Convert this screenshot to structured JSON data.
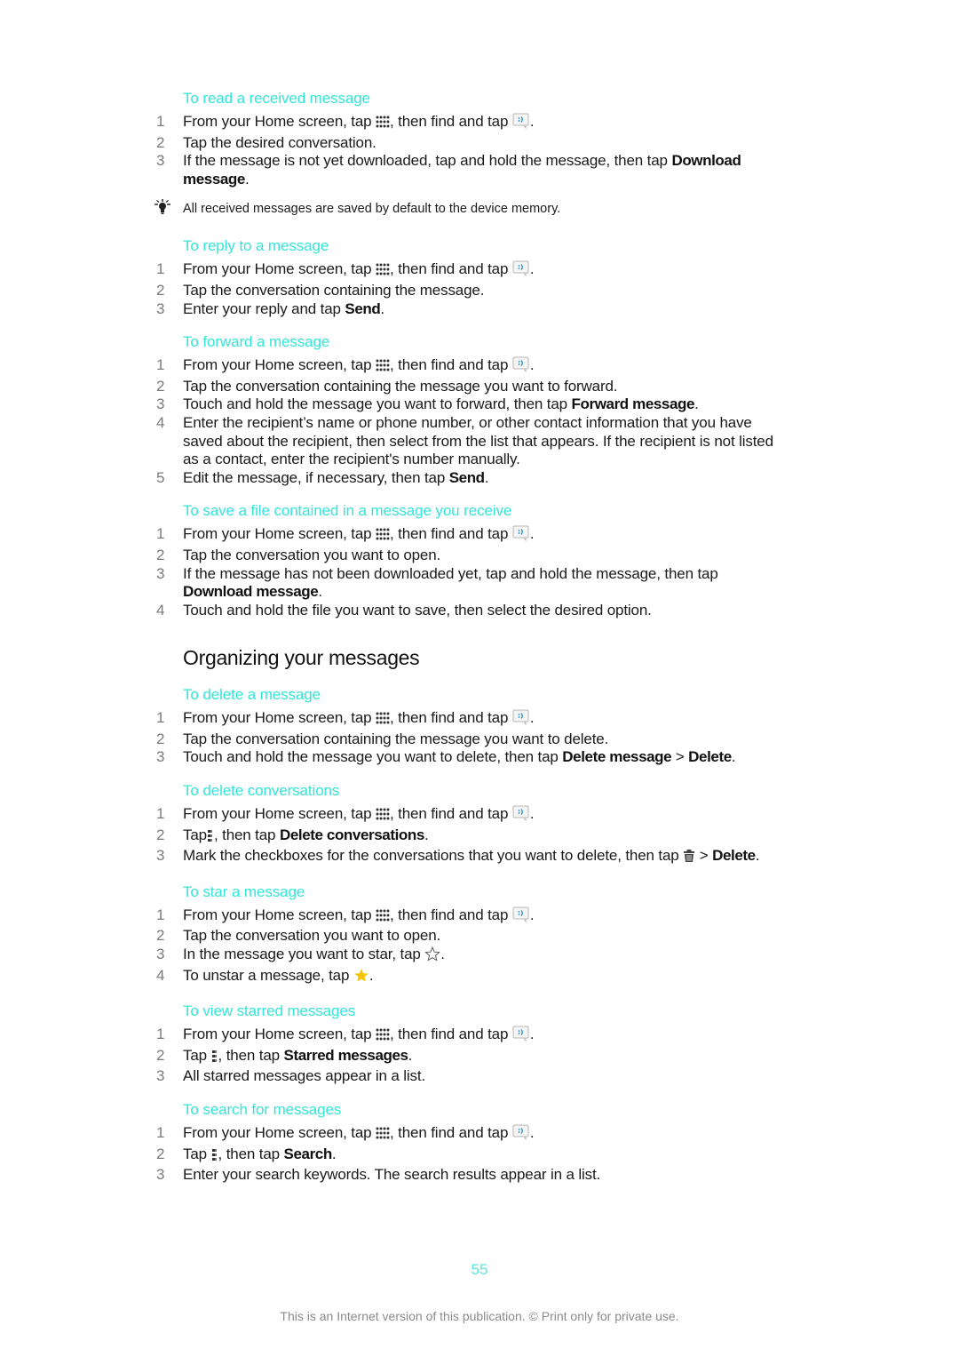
{
  "sections": [
    {
      "heading": "To read a received message",
      "steps": [
        {
          "n": "1",
          "parts": [
            {
              "t": "From your Home screen, tap "
            },
            {
              "icon": "apps"
            },
            {
              "t": ", then find and tap "
            },
            {
              "icon": "messaging"
            },
            {
              "t": "."
            }
          ]
        },
        {
          "n": "2",
          "parts": [
            {
              "t": "Tap the desired conversation."
            }
          ]
        },
        {
          "n": "3",
          "parts": [
            {
              "t": "If the message is not yet downloaded, tap and hold the message, then tap "
            },
            {
              "b": "Download message"
            },
            {
              "t": "."
            }
          ]
        }
      ],
      "tip": "All received messages are saved by default to the device memory."
    },
    {
      "heading": "To reply to a message",
      "steps": [
        {
          "n": "1",
          "parts": [
            {
              "t": "From your Home screen, tap "
            },
            {
              "icon": "apps"
            },
            {
              "t": ", then find and tap "
            },
            {
              "icon": "messaging"
            },
            {
              "t": "."
            }
          ]
        },
        {
          "n": "2",
          "parts": [
            {
              "t": "Tap the conversation containing the message."
            }
          ]
        },
        {
          "n": "3",
          "parts": [
            {
              "t": "Enter your reply and tap "
            },
            {
              "b": "Send"
            },
            {
              "t": "."
            }
          ]
        }
      ]
    },
    {
      "heading": "To forward a message",
      "steps": [
        {
          "n": "1",
          "parts": [
            {
              "t": "From your Home screen, tap "
            },
            {
              "icon": "apps"
            },
            {
              "t": ", then find and tap "
            },
            {
              "icon": "messaging"
            },
            {
              "t": "."
            }
          ]
        },
        {
          "n": "2",
          "parts": [
            {
              "t": "Tap the conversation containing the message you want to forward."
            }
          ]
        },
        {
          "n": "3",
          "parts": [
            {
              "t": "Touch and hold the message you want to forward, then tap "
            },
            {
              "b": "Forward message"
            },
            {
              "t": "."
            }
          ]
        },
        {
          "n": "4",
          "parts": [
            {
              "t": "Enter the recipient’s name or phone number, or other contact information that you have saved about the recipient, then select from the list that appears. If the recipient is not listed as a contact, enter the recipient's number manually."
            }
          ]
        },
        {
          "n": "5",
          "parts": [
            {
              "t": "Edit the message, if necessary, then tap "
            },
            {
              "b": "Send"
            },
            {
              "t": "."
            }
          ]
        }
      ]
    },
    {
      "heading": "To save a file contained in a message you receive",
      "steps": [
        {
          "n": "1",
          "parts": [
            {
              "t": "From your Home screen, tap "
            },
            {
              "icon": "apps"
            },
            {
              "t": ", then find and tap "
            },
            {
              "icon": "messaging"
            },
            {
              "t": "."
            }
          ]
        },
        {
          "n": "2",
          "parts": [
            {
              "t": "Tap the conversation you want to open."
            }
          ]
        },
        {
          "n": "3",
          "parts": [
            {
              "t": "If the message has not been downloaded yet, tap and hold the message, then tap "
            },
            {
              "b": "Download message"
            },
            {
              "t": "."
            }
          ]
        },
        {
          "n": "4",
          "parts": [
            {
              "t": "Touch and hold the file you want to save, then select the desired option."
            }
          ]
        }
      ]
    },
    {
      "title": "Organizing your messages"
    },
    {
      "heading": "To delete a message",
      "steps": [
        {
          "n": "1",
          "parts": [
            {
              "t": "From your Home screen, tap "
            },
            {
              "icon": "apps"
            },
            {
              "t": ", then find and tap "
            },
            {
              "icon": "messaging"
            },
            {
              "t": "."
            }
          ]
        },
        {
          "n": "2",
          "parts": [
            {
              "t": "Tap the conversation containing the message you want to delete."
            }
          ]
        },
        {
          "n": "3",
          "parts": [
            {
              "t": "Touch and hold the message you want to delete, then tap "
            },
            {
              "b": "Delete message"
            },
            {
              "t": " > "
            },
            {
              "b": "Delete"
            },
            {
              "t": "."
            }
          ]
        }
      ]
    },
    {
      "heading": "To delete conversations",
      "steps": [
        {
          "n": "1",
          "parts": [
            {
              "t": "From your Home screen, tap "
            },
            {
              "icon": "apps"
            },
            {
              "t": ", then find and tap "
            },
            {
              "icon": "messaging"
            },
            {
              "t": "."
            }
          ]
        },
        {
          "n": "2",
          "parts": [
            {
              "t": "Tap"
            },
            {
              "icon": "menu"
            },
            {
              "t": ", then tap "
            },
            {
              "b": "Delete conversations"
            },
            {
              "t": "."
            }
          ]
        },
        {
          "n": "3",
          "parts": [
            {
              "t": "Mark the checkboxes for the conversations that you want to delete, then tap "
            },
            {
              "icon": "trash"
            },
            {
              "t": " > "
            },
            {
              "b": "Delete"
            },
            {
              "t": "."
            }
          ]
        }
      ]
    },
    {
      "heading": "To star a message",
      "steps": [
        {
          "n": "1",
          "parts": [
            {
              "t": "From your Home screen, tap "
            },
            {
              "icon": "apps"
            },
            {
              "t": ", then find and tap "
            },
            {
              "icon": "messaging"
            },
            {
              "t": "."
            }
          ]
        },
        {
          "n": "2",
          "parts": [
            {
              "t": "Tap the conversation you want to open."
            }
          ]
        },
        {
          "n": "3",
          "parts": [
            {
              "t": "In the message you want to star, tap "
            },
            {
              "icon": "star-outline"
            },
            {
              "t": "."
            }
          ]
        },
        {
          "n": "4",
          "parts": [
            {
              "t": "To unstar a message, tap "
            },
            {
              "icon": "star-filled"
            },
            {
              "t": "."
            }
          ]
        }
      ]
    },
    {
      "heading": "To view starred messages",
      "steps": [
        {
          "n": "1",
          "parts": [
            {
              "t": "From your Home screen, tap "
            },
            {
              "icon": "apps"
            },
            {
              "t": ", then find and tap "
            },
            {
              "icon": "messaging"
            },
            {
              "t": "."
            }
          ]
        },
        {
          "n": "2",
          "parts": [
            {
              "t": "Tap "
            },
            {
              "icon": "menu"
            },
            {
              "t": ", then tap "
            },
            {
              "b": "Starred messages"
            },
            {
              "t": "."
            }
          ]
        },
        {
          "n": "3",
          "parts": [
            {
              "t": "All starred messages appear in a list."
            }
          ]
        }
      ]
    },
    {
      "heading": "To search for messages",
      "steps": [
        {
          "n": "1",
          "parts": [
            {
              "t": "From your Home screen, tap "
            },
            {
              "icon": "apps"
            },
            {
              "t": ", then find and tap "
            },
            {
              "icon": "messaging"
            },
            {
              "t": "."
            }
          ]
        },
        {
          "n": "2",
          "parts": [
            {
              "t": "Tap "
            },
            {
              "icon": "menu"
            },
            {
              "t": ", then tap "
            },
            {
              "b": "Search"
            },
            {
              "t": "."
            }
          ]
        },
        {
          "n": "3",
          "parts": [
            {
              "t": "Enter your search keywords. The search results appear in a list."
            }
          ]
        }
      ]
    }
  ],
  "page_number": "55",
  "footer": "This is an Internet version of this publication. © Print only for private use.",
  "colors": {
    "heading": "#33e6d8",
    "star": "#f5c400",
    "step_number": "#7a7a7a"
  }
}
